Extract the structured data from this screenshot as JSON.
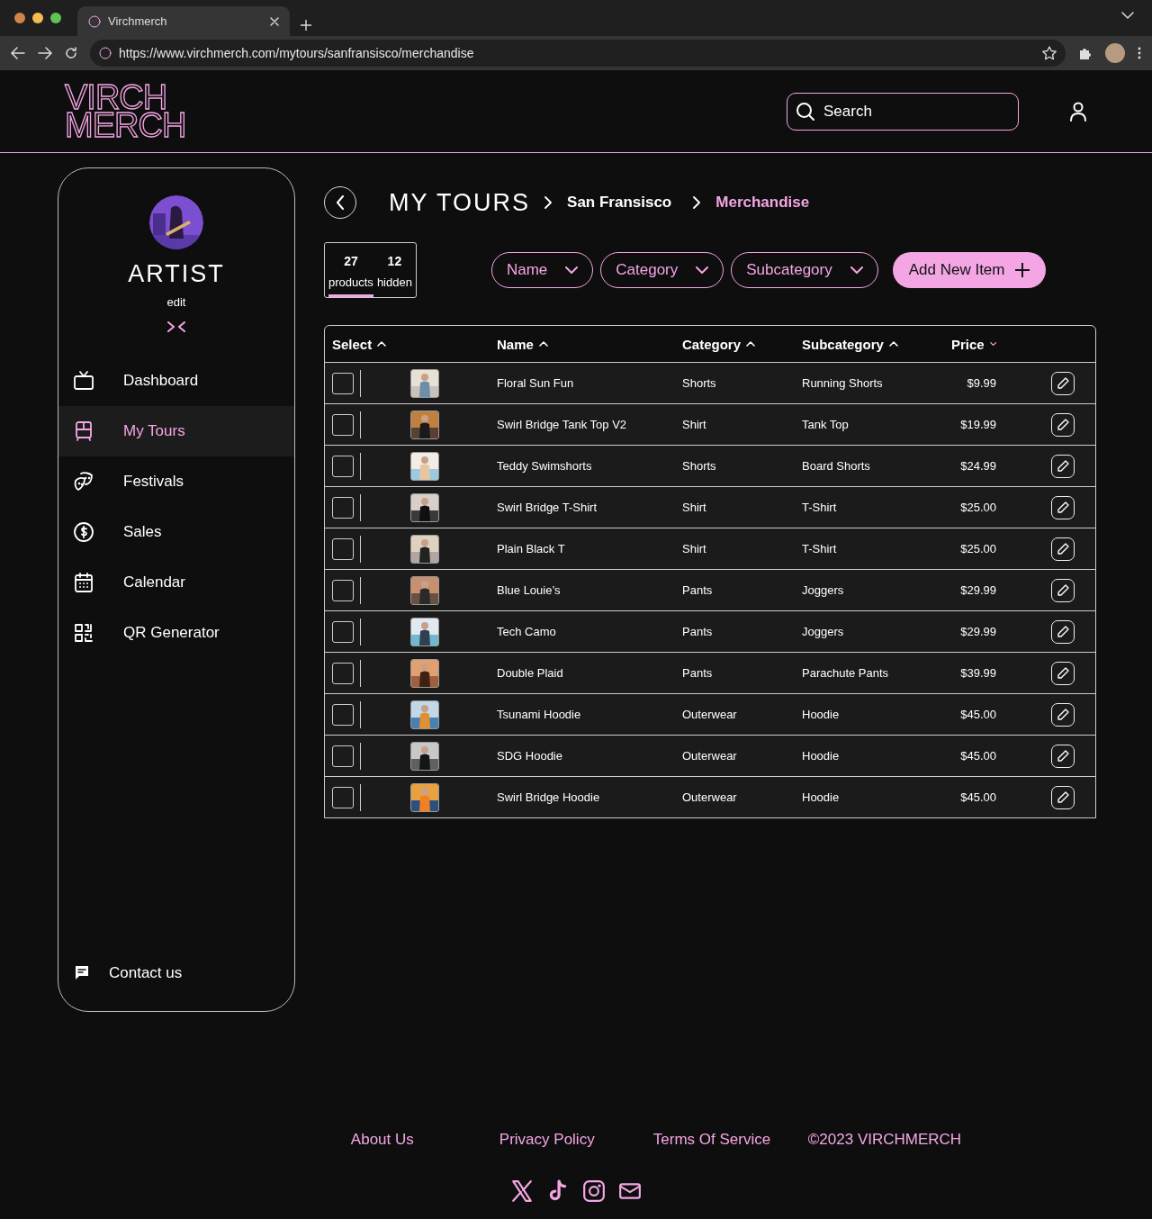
{
  "browser": {
    "tab_title": "Virchmerch",
    "url": "https://www.virchmerch.com/mytours/sanfransisco/merchandise"
  },
  "header": {
    "logo_lines": [
      "VIRCH",
      "MERCH"
    ],
    "search": {
      "placeholder": "Search"
    }
  },
  "sidebar": {
    "profile": {
      "name": "ARTIST",
      "edit": "edit"
    },
    "items": [
      {
        "label": "Dashboard",
        "selected": false
      },
      {
        "label": "My Tours",
        "selected": true
      },
      {
        "label": "Festivals",
        "selected": false
      },
      {
        "label": "Sales",
        "selected": false
      },
      {
        "label": "Calendar",
        "selected": false
      },
      {
        "label": "QR Generator",
        "selected": false
      }
    ],
    "contact": "Contact us"
  },
  "breadcrumb": [
    "MY TOURS",
    "San Fransisco",
    "Merchandise"
  ],
  "stats": [
    {
      "count": "27",
      "label": "products",
      "selected": true
    },
    {
      "count": "12",
      "label": "hidden",
      "selected": false
    }
  ],
  "filters": [
    "Name",
    "Category",
    "Subcategory"
  ],
  "add_button": "Add New Item",
  "table": {
    "columns": [
      {
        "label": "Select",
        "active": false
      },
      {
        "label": "Name",
        "active": false
      },
      {
        "label": "Category",
        "active": false
      },
      {
        "label": "Subcategory",
        "active": false
      },
      {
        "label": "Price",
        "active": true
      }
    ],
    "rows": [
      {
        "checked": false,
        "name": "Floral Sun Fun",
        "category": "Shorts",
        "subcategory": "Running Shorts",
        "price": "$9.99"
      },
      {
        "checked": false,
        "name": "Swirl Bridge Tank Top V2",
        "category": "Shirt",
        "subcategory": "Tank Top",
        "price": "$19.99"
      },
      {
        "checked": false,
        "name": "Teddy Swimshorts",
        "category": "Shorts",
        "subcategory": "Board Shorts",
        "price": "$24.99"
      },
      {
        "checked": false,
        "name": "Swirl Bridge T-Shirt",
        "category": "Shirt",
        "subcategory": "T-Shirt",
        "price": "$25.00"
      },
      {
        "checked": false,
        "name": "Plain Black T",
        "category": "Shirt",
        "subcategory": "T-Shirt",
        "price": "$25.00"
      },
      {
        "checked": false,
        "name": "Blue Louie’s",
        "category": "Pants",
        "subcategory": "Joggers",
        "price": "$29.99"
      },
      {
        "checked": false,
        "name": "Tech Camo",
        "category": "Pants",
        "subcategory": "Joggers",
        "price": "$29.99"
      },
      {
        "checked": false,
        "name": "Double Plaid",
        "category": "Pants",
        "subcategory": "Parachute Pants",
        "price": "$39.99"
      },
      {
        "checked": false,
        "name": "Tsunami Hoodie",
        "category": "Outerwear",
        "subcategory": "Hoodie",
        "price": "$45.00"
      },
      {
        "checked": false,
        "name": "SDG Hoodie",
        "category": "Outerwear",
        "subcategory": "Hoodie",
        "price": "$45.00"
      },
      {
        "checked": false,
        "name": "Swirl Bridge Hoodie",
        "category": "Outerwear",
        "subcategory": "Hoodie",
        "price": "$45.00"
      }
    ]
  },
  "footer": {
    "links": [
      "About Us",
      "Privacy Policy",
      "Terms Of Service"
    ],
    "copyright": "©2023 VIRCHMERCH"
  }
}
